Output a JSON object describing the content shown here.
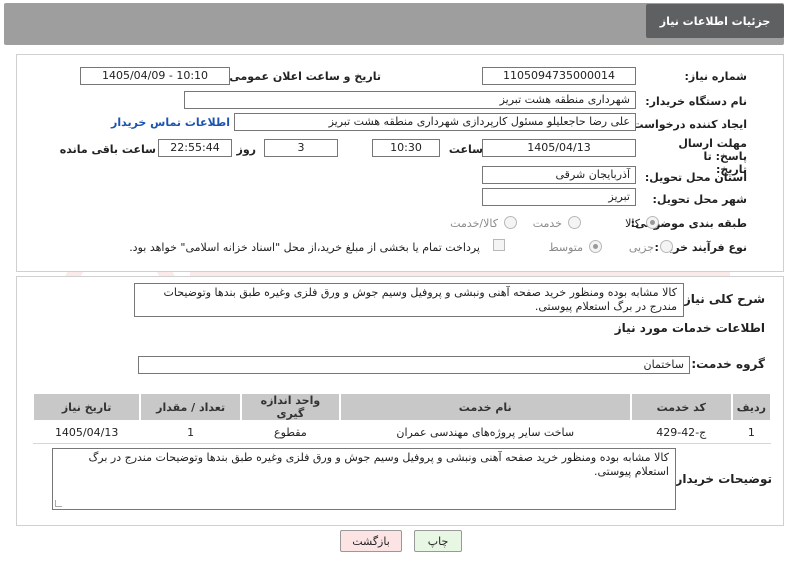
{
  "header": {
    "title": "جزئیات اطلاعات نیاز"
  },
  "need": {
    "number_label": "شماره نیاز:",
    "number_value": "1105094735000014",
    "announce_label": "تاریخ و ساعت اعلان عمومی:",
    "announce_value": "1405/04/09 - 10:10",
    "buyer_label": "نام دستگاه خریدار:",
    "buyer_value": "شهرداری منطقه هشت تبریز",
    "creator_label": "ایجاد کننده درخواست:",
    "creator_value": "علی رضا حاجعلیلو مسئول کارپردازی شهرداری منطقه هشت تبریز",
    "contact_link": "اطلاعات تماس خریدار",
    "deadline_label": "مهلت ارسال پاسخ: تا تاریخ:",
    "deadline_date": "1405/04/13",
    "hour_label": "ساعت",
    "deadline_time": "10:30",
    "days_value": "3",
    "days_label": "روز و",
    "remaining_value": "22:55:44",
    "remaining_label": "ساعت باقی مانده",
    "province_label": "استان محل تحویل:",
    "province_value": "آذربایجان شرقی",
    "city_label": "شهر محل تحویل:",
    "city_value": "تبریز",
    "category_label": "طبقه بندی موضوعی:",
    "category_options": [
      "کالا",
      "خدمت",
      "کالا/خدمت"
    ],
    "process_label": "نوع فرآیند خرید :",
    "process_options": [
      "جزیی",
      "متوسط"
    ],
    "payment_note": "پرداخت تمام یا بخشی از مبلغ خرید،از محل \"اسناد خزانه اسلامی\" خواهد بود."
  },
  "summary": {
    "label": "شرح کلی نیاز:",
    "text": "کالا مشابه بوده ومنظور خرید صفحه آهنی ونبشی و پروفیل وسیم جوش و ورق فلزی وغیره طبق بندها وتوضیحات مندرج در برگ استعلام پیوستی."
  },
  "services": {
    "section_title": "اطلاعات خدمات مورد نیاز",
    "group_label": "گروه خدمت:",
    "group_value": "ساختمان",
    "columns": [
      "ردیف",
      "کد خدمت",
      "نام خدمت",
      "واحد اندازه گیری",
      "تعداد / مقدار",
      "تاریخ نیاز"
    ],
    "rows": [
      [
        "1",
        "ج-42-429",
        "ساخت سایر پروژه‌های مهندسی عمران",
        "مقطوع",
        "1",
        "1405/04/13"
      ]
    ]
  },
  "buyer_notes": {
    "label": "توضیحات خریدار:",
    "text": "کالا مشابه بوده ومنظور خرید صفحه آهنی ونبشی و پروفیل وسیم جوش و ورق فلزی وغیره طبق بندها وتوضیحات مندرج در برگ استعلام پیوستی."
  },
  "buttons": {
    "print": "چاپ",
    "back": "بازگشت"
  },
  "colors": {
    "header_bg": "#9e9e9e",
    "tab_bg": "#5f6061",
    "link": "#1a53b0",
    "back_btn_bg": "#fde4e4",
    "print_btn_bg": "#e8f7e4"
  }
}
